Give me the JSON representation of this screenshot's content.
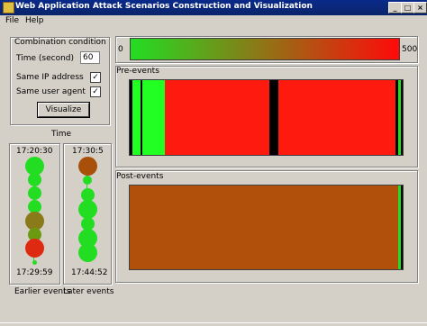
{
  "window": {
    "title": "Web Application Attack Scenarios Construction and Visualization"
  },
  "window_buttons": {
    "minimize": "_",
    "maximize": "□",
    "close": "×"
  },
  "menu": {
    "items": [
      "File",
      "Help"
    ]
  },
  "combination": {
    "title": "Combination condition",
    "time_label": "Time (second)",
    "time_value": "60",
    "same_ip_label": "Same IP address",
    "same_ip_checked": true,
    "same_agent_label": "Same user agent",
    "same_agent_checked": true,
    "visualize_label": "Visualize"
  },
  "time_section": {
    "title": "Time",
    "earlier": {
      "start": "17:20:30",
      "end": "17:29:59",
      "caption": "Earlier events",
      "dots": [
        {
          "color": "#22dd22",
          "size": "large"
        },
        {
          "color": "#22dd22",
          "size": "medium"
        },
        {
          "color": "#22dd22",
          "size": "medium"
        },
        {
          "color": "#22dd22",
          "size": "medium"
        },
        {
          "color": "#8a7a1a",
          "size": "large"
        },
        {
          "color": "#6a9a10",
          "size": "medium"
        },
        {
          "color": "#dd2a10",
          "size": "large"
        },
        {
          "color": "#22dd22",
          "size": "tiny"
        }
      ]
    },
    "later": {
      "start": "17:30:5",
      "end": "17:44:52",
      "caption": "Later events",
      "dots": [
        {
          "color": "#a8500a",
          "size": "large"
        },
        {
          "color": "#22dd22",
          "size": "small"
        },
        {
          "color": "#22dd22",
          "size": "medium"
        },
        {
          "color": "#22dd22",
          "size": "large"
        },
        {
          "color": "#22dd22",
          "size": "medium"
        },
        {
          "color": "#22dd22",
          "size": "large"
        },
        {
          "color": "#22dd22",
          "size": "large"
        }
      ]
    }
  },
  "scale": {
    "min": "0",
    "max": "500",
    "colors": [
      "#22dd22",
      "#ff0a0a"
    ]
  },
  "pre_events": {
    "title": "Pre-events",
    "segments": [
      {
        "from": 0.0,
        "to": 0.01,
        "color": "#000000"
      },
      {
        "from": 0.01,
        "to": 0.04,
        "color": "#22ff22"
      },
      {
        "from": 0.04,
        "to": 0.045,
        "color": "#000000"
      },
      {
        "from": 0.045,
        "to": 0.13,
        "color": "#22ff22"
      },
      {
        "from": 0.13,
        "to": 0.51,
        "color": "#ff1a10"
      },
      {
        "from": 0.51,
        "to": 0.545,
        "color": "#000000"
      },
      {
        "from": 0.545,
        "to": 0.975,
        "color": "#ff1a10"
      },
      {
        "from": 0.975,
        "to": 0.985,
        "color": "#000000"
      },
      {
        "from": 0.985,
        "to": 0.993,
        "color": "#22dd22"
      },
      {
        "from": 0.993,
        "to": 1.0,
        "color": "#000000"
      }
    ]
  },
  "post_events": {
    "title": "Post-events",
    "segments": [
      {
        "from": 0.0,
        "to": 0.985,
        "color": "#b0500a"
      },
      {
        "from": 0.985,
        "to": 0.992,
        "color": "#22dd22"
      },
      {
        "from": 0.992,
        "to": 1.0,
        "color": "#000000"
      }
    ]
  }
}
